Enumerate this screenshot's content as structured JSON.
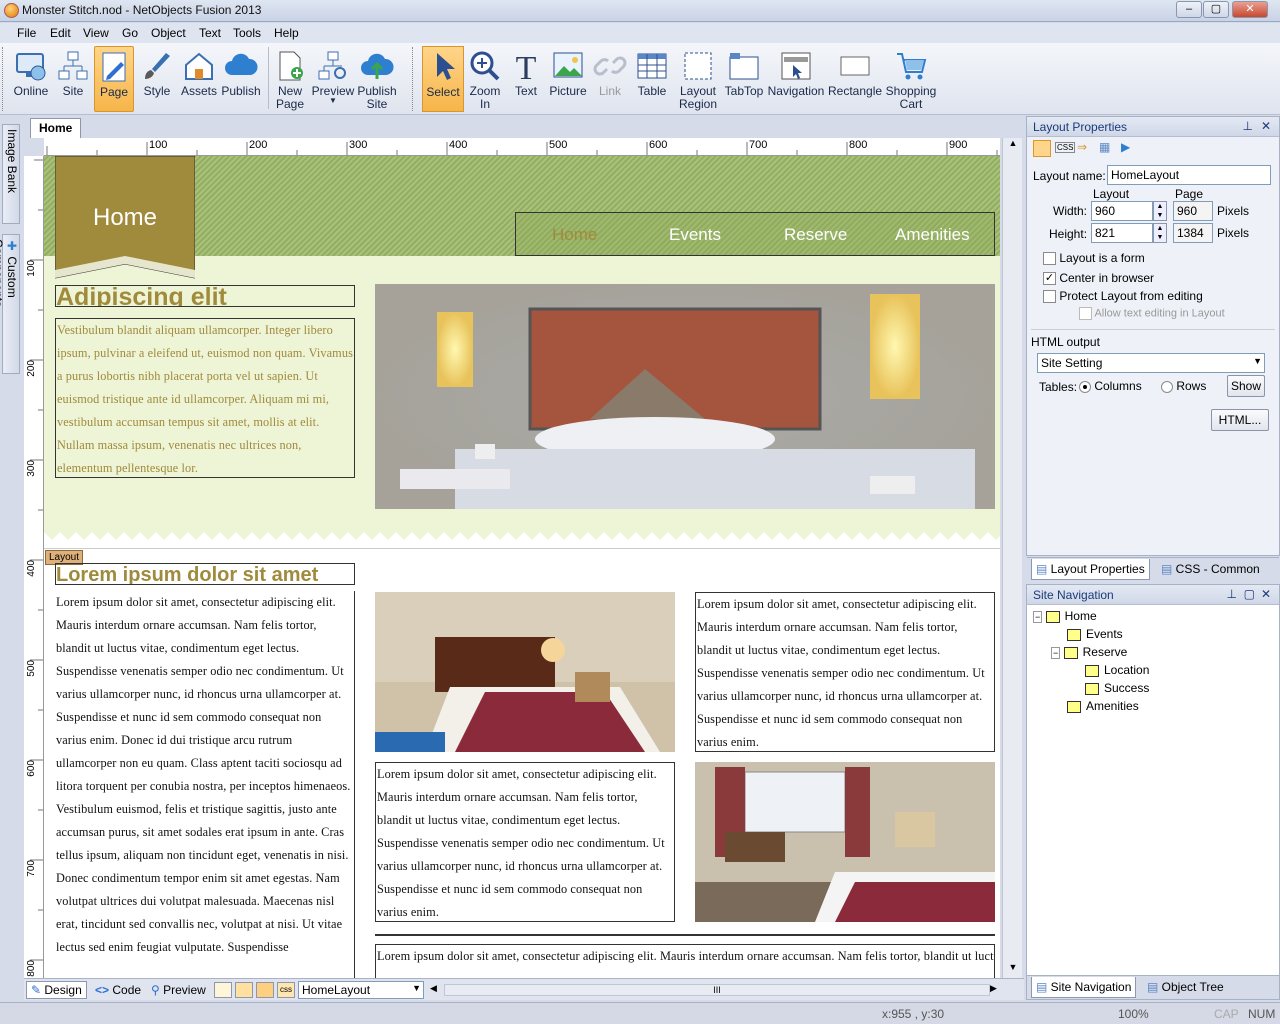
{
  "window": {
    "title": "Monster Stitch.nod - NetObjects Fusion 2013",
    "min": "–",
    "max": "▢",
    "close": "✕"
  },
  "menu": [
    "File",
    "Edit",
    "View",
    "Go",
    "Object",
    "Text",
    "Tools",
    "Help"
  ],
  "toolbar": {
    "items": [
      {
        "label": "Online",
        "icon": "online-icon"
      },
      {
        "label": "Site",
        "icon": "site-icon"
      },
      {
        "label": "Page",
        "icon": "page-icon"
      },
      {
        "label": "Style",
        "icon": "style-icon"
      },
      {
        "label": "Assets",
        "icon": "assets-icon"
      },
      {
        "label": "Publish",
        "icon": "publish-icon"
      },
      {
        "label": "New\nPage",
        "icon": "new-page-icon"
      },
      {
        "label": "Preview",
        "icon": "preview-icon"
      },
      {
        "label": "Publish\nSite",
        "icon": "publish-site-icon"
      }
    ],
    "tools": [
      {
        "label": "Select",
        "icon": "select-icon"
      },
      {
        "label": "Zoom\nIn",
        "icon": "zoom-icon"
      },
      {
        "label": "Text",
        "icon": "text-icon"
      },
      {
        "label": "Picture",
        "icon": "picture-icon"
      },
      {
        "label": "Link",
        "icon": "link-icon"
      },
      {
        "label": "Table",
        "icon": "table-icon"
      },
      {
        "label": "Layout\nRegion",
        "icon": "layout-region-icon"
      },
      {
        "label": "TabTop",
        "icon": "tabtop-icon"
      },
      {
        "label": "Navigation",
        "icon": "navigation-icon"
      },
      {
        "label": "Rectangle",
        "icon": "rectangle-icon"
      },
      {
        "label": "Shopping\nCart",
        "icon": "shopping-cart-icon"
      }
    ]
  },
  "left_tabs": {
    "image_bank": "Image Bank",
    "custom_components": "Custom Components"
  },
  "doc_tab": "Home",
  "ruler": {
    "h_labels": [
      "100",
      "200",
      "300",
      "400",
      "500",
      "600",
      "700",
      "800",
      "900"
    ],
    "v_labels": [
      "100",
      "200",
      "300",
      "400",
      "500",
      "600",
      "700",
      "800"
    ]
  },
  "page": {
    "banner_title": "Home",
    "nav": [
      "Home",
      "Events",
      "Reserve",
      "Amenities"
    ],
    "heading1": "Adipiscing elit",
    "intro": "Vestibulum blandit aliquam ullamcorper. Integer libero ipsum, pulvinar a eleifend ut, euismod non quam. Vivamus a purus lobortis nibh placerat porta vel ut sapien. Ut euismod tristique ante id ullamcorper. Aliquam mi mi, vestibulum accumsan tempus sit amet, mollis at elit. Nullam massa ipsum, venenatis nec ultrices non, elementum pellentesque lor.",
    "layout_tag": "Layout",
    "heading2": "Lorem ipsum dolor sit amet",
    "col_left": "Lorem ipsum dolor sit amet, consectetur adipiscing elit. Mauris interdum ornare accumsan. Nam felis tortor, blandit ut luctus vitae, condimentum eget lectus. Suspendisse venenatis semper odio nec condimentum. Ut varius ullamcorper nunc, id rhoncus urna ullamcorper at. Suspendisse et nunc id sem commodo consequat non varius enim. Donec id dui tristique arcu rutrum ullamcorper non eu quam. Class aptent taciti sociosqu ad litora torquent per conubia nostra, per inceptos himenaeos. Vestibulum euismod, felis et tristique sagittis, justo ante accumsan purus, sit amet sodales erat ipsum in ante. Cras tellus ipsum, aliquam non tincidunt eget, venenatis in nisi. Donec condimentum tempor enim sit amet egestas. Nam volutpat ultrices dui volutpat malesuada. Maecenas nisl erat, tincidunt sed convallis nec, volutpat at nisi. Ut vitae lectus sed enim feugiat vulputate. Suspendisse",
    "col_right_top": "Lorem ipsum dolor sit amet, consectetur adipiscing elit. Mauris interdum ornare accumsan. Nam felis tortor, blandit ut luctus vitae, condimentum eget lectus. Suspendisse venenatis semper odio nec condimentum. Ut varius ullamcorper nunc, id rhoncus urna ullamcorper at. Suspendisse et nunc id sem commodo consequat non varius enim.",
    "col_mid_bottom": "Lorem ipsum dolor sit amet, consectetur adipiscing elit. Mauris interdum ornare accumsan. Nam felis tortor, blandit ut luctus vitae, condimentum eget lectus. Suspendisse venenatis semper odio nec condimentum. Ut varius ullamcorper nunc, id rhoncus urna ullamcorper at. Suspendisse et nunc id sem commodo consequat non varius enim.",
    "wide_text": "Lorem ipsum dolor sit amet, consectetur adipiscing elit. Mauris interdum ornare accumsan. Nam felis tortor, blandit ut luctus vitae, condimentum eget lectus. Suspendisse venenatis semper odio nec condimentum."
  },
  "bottom_tabs": {
    "design": "Design",
    "code": "Code",
    "preview": "Preview",
    "layout_select": "HomeLayout",
    "grip": "III"
  },
  "status": {
    "coords": "x:955 , y:30",
    "zoom": "100%",
    "cap": "CAP",
    "num": "NUM"
  },
  "layout_properties": {
    "title": "Layout Properties",
    "layout_name_label": "Layout name:",
    "layout_name": "HomeLayout",
    "col_layout": "Layout",
    "col_page": "Page",
    "width_label": "Width:",
    "height_label": "Height:",
    "width": "960",
    "height": "821",
    "page_width": "960",
    "page_height": "1384",
    "pixels": "Pixels",
    "chk_form": "Layout is a form",
    "chk_center": "Center in browser",
    "chk_protect": "Protect Layout from editing",
    "chk_allow": "Allow text editing in Layout",
    "html_output_label": "HTML output",
    "html_output": "Site Setting",
    "tables_label": "Tables:",
    "radio_columns": "Columns",
    "radio_rows": "Rows",
    "show_btn": "Show",
    "html_btn": "HTML...",
    "tab1": "Layout Properties",
    "tab2": "CSS - Common"
  },
  "site_navigation": {
    "title": "Site Navigation",
    "tree": [
      "Home",
      "Events",
      "Reserve",
      "Location",
      "Success",
      "Amenities"
    ],
    "tab1": "Site Navigation",
    "tab2": "Object Tree"
  },
  "colors": {
    "accent": "#a08a3c",
    "banner": "#9bb76b",
    "page_bg": "#eef4d6",
    "selection": "#f6b54a"
  }
}
